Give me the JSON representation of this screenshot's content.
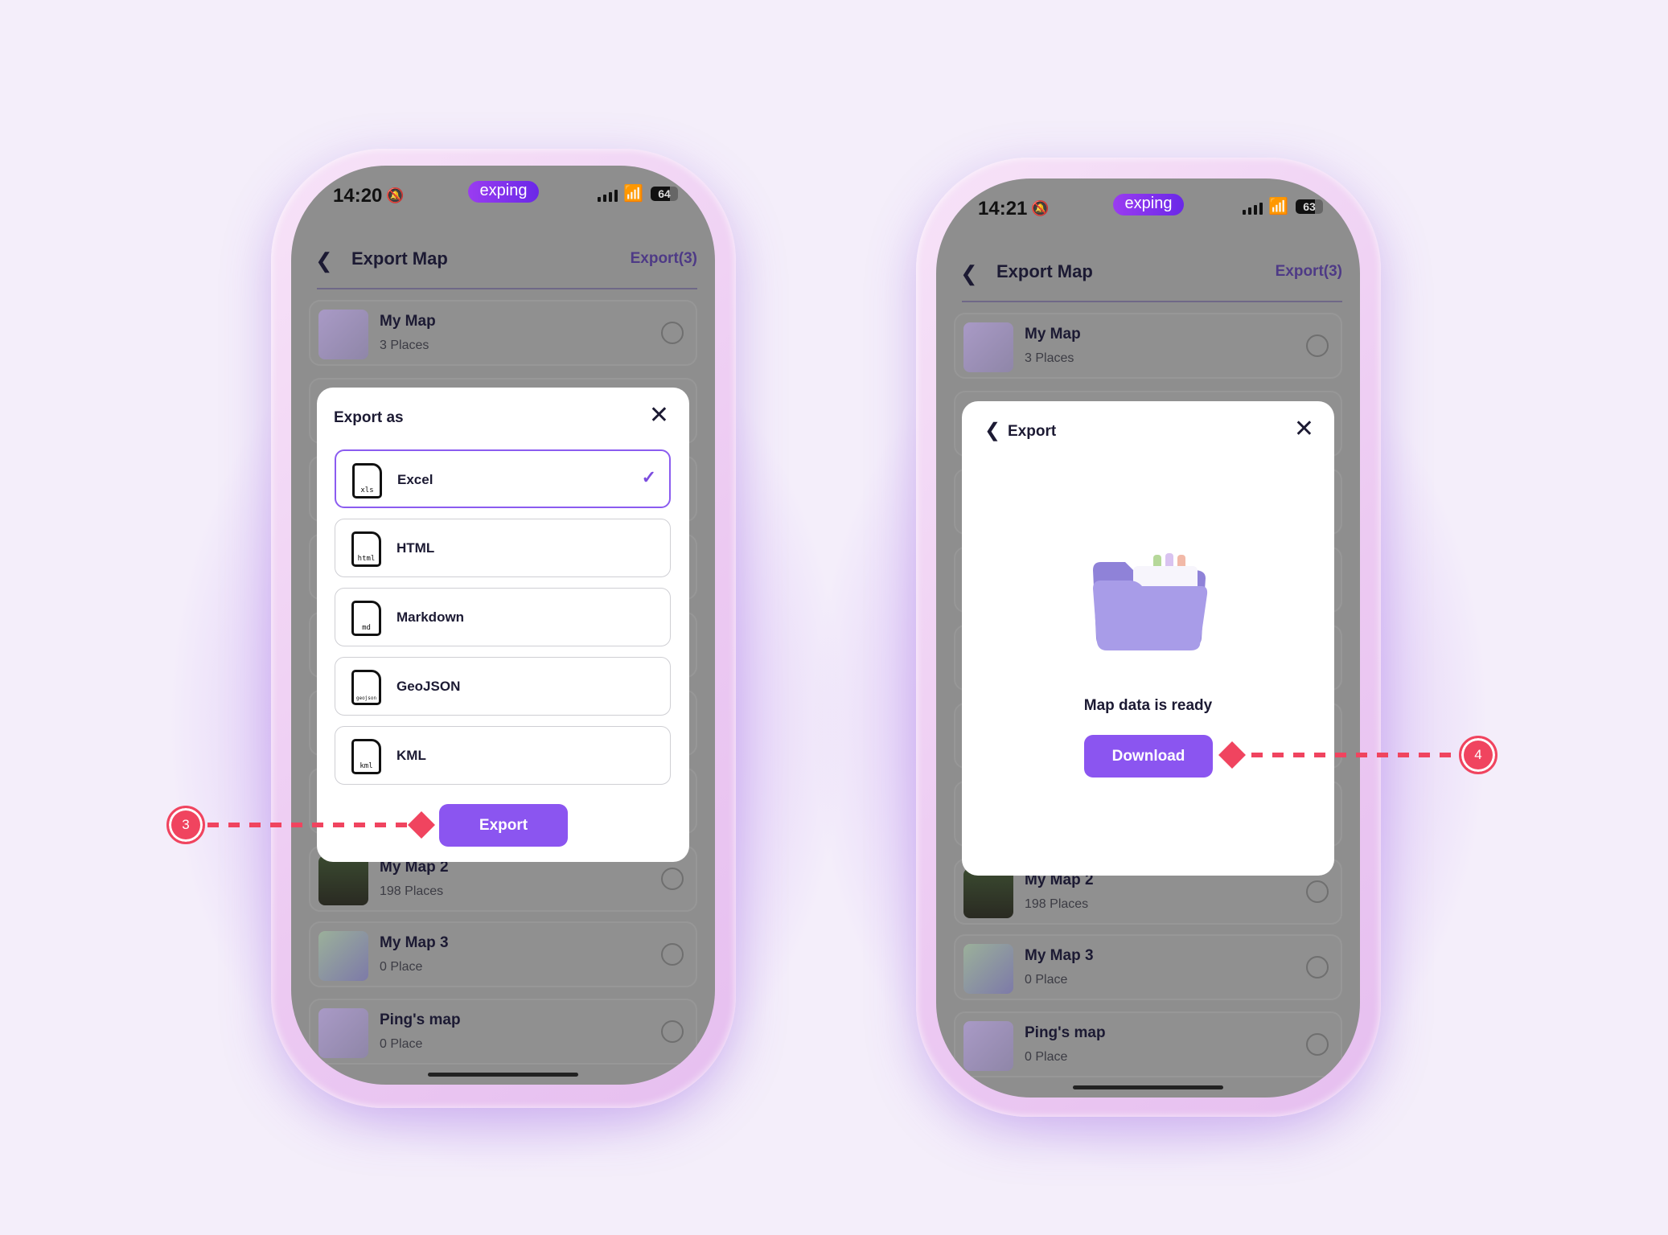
{
  "colors": {
    "accent": "#8b55f0",
    "annotation": "#f0445f",
    "check": "#7c4ddf"
  },
  "phones": [
    {
      "status": {
        "time": "14:20",
        "app_pill": "exping",
        "battery": "64"
      },
      "header": {
        "title": "Export Map",
        "action": "Export(3)"
      },
      "maps": [
        {
          "name": "My Map",
          "places": "3 Places"
        },
        {
          "name": "My Map 2",
          "places": "198 Places"
        },
        {
          "name": "My Map 3",
          "places": "0 Place"
        },
        {
          "name": "Ping's map",
          "places": "0 Place"
        }
      ],
      "modal": {
        "title": "Export as",
        "options": [
          {
            "label": "Excel",
            "ext": "xls",
            "selected": true
          },
          {
            "label": "HTML",
            "ext": "html",
            "selected": false
          },
          {
            "label": "Markdown",
            "ext": "md",
            "selected": false
          },
          {
            "label": "GeoJSON",
            "ext": "geojson",
            "selected": false
          },
          {
            "label": "KML",
            "ext": "kml",
            "selected": false
          }
        ],
        "button": "Export"
      }
    },
    {
      "status": {
        "time": "14:21",
        "app_pill": "exping",
        "battery": "63"
      },
      "header": {
        "title": "Export Map",
        "action": "Export(3)"
      },
      "maps": [
        {
          "name": "My Map",
          "places": "3 Places"
        },
        {
          "name": "My Map 2",
          "places": "198 Places"
        },
        {
          "name": "My Map 3",
          "places": "0 Place"
        },
        {
          "name": "Ping's map",
          "places": "0 Place"
        }
      ],
      "modal": {
        "title": "Export",
        "message": "Map data is ready",
        "button": "Download"
      }
    }
  ],
  "annotations": [
    {
      "step": "3"
    },
    {
      "step": "4"
    }
  ]
}
